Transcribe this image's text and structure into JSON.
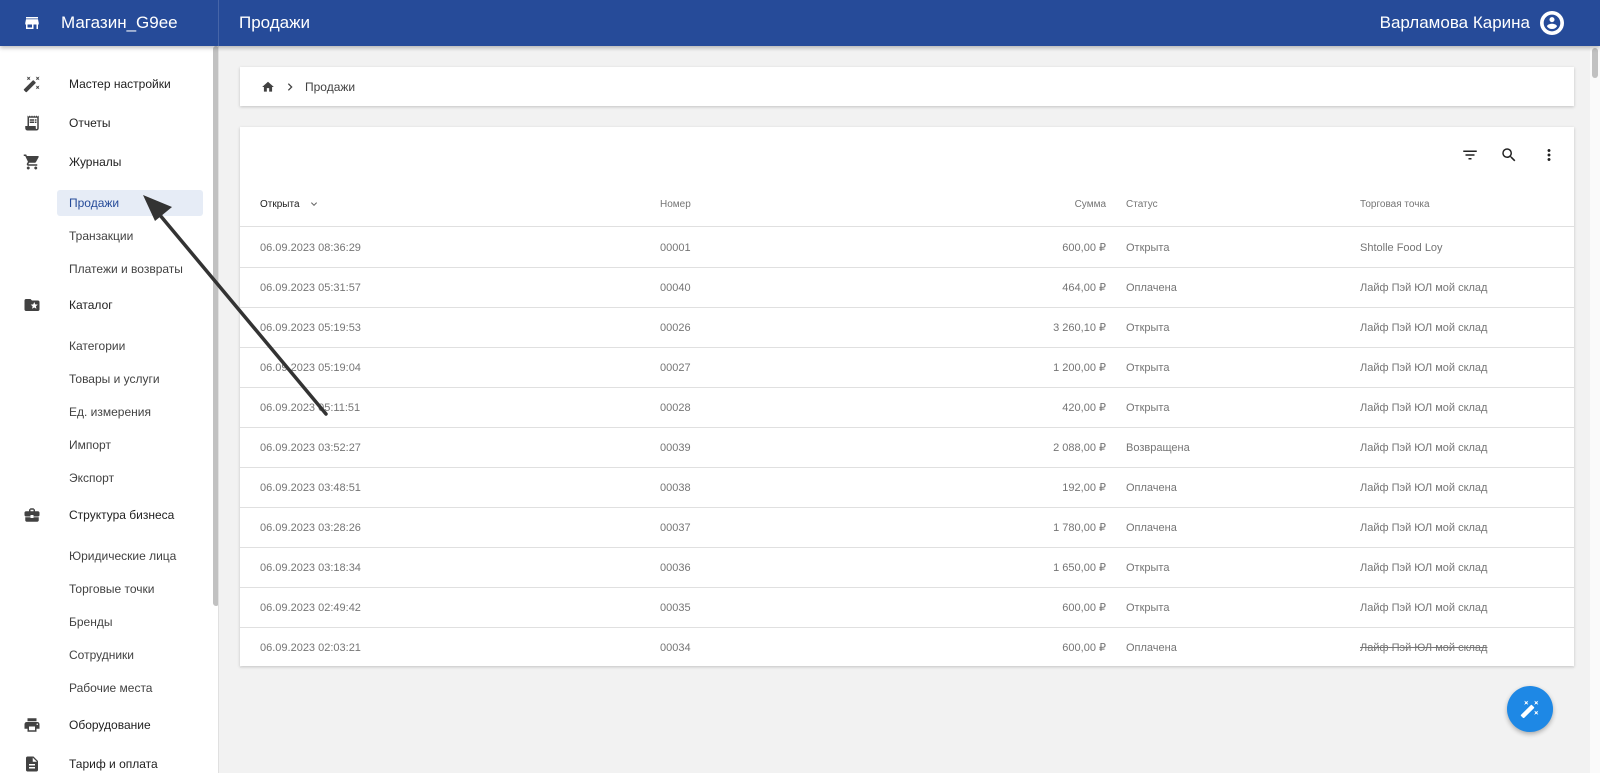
{
  "header": {
    "app_name": "Магазин_G9ee",
    "page_title": "Продажи",
    "user_name": "Варламова Карина"
  },
  "sidebar": {
    "sections": [
      {
        "label": "Мастер настройки",
        "icon": "magic-wand-icon"
      },
      {
        "label": "Отчеты",
        "icon": "receipt-icon"
      },
      {
        "label": "Журналы",
        "icon": "cart-icon",
        "children": [
          {
            "label": "Продажи",
            "active": true
          },
          {
            "label": "Транзакции"
          },
          {
            "label": "Платежи и возвраты"
          }
        ]
      },
      {
        "label": "Каталог",
        "icon": "folder-star-icon",
        "children": [
          {
            "label": "Категории"
          },
          {
            "label": "Товары и услуги"
          },
          {
            "label": "Ед. измерения"
          },
          {
            "label": "Импорт"
          },
          {
            "label": "Экспорт"
          }
        ]
      },
      {
        "label": "Структура бизнеса",
        "icon": "briefcase-icon",
        "children": [
          {
            "label": "Юридические лица"
          },
          {
            "label": "Торговые точки"
          },
          {
            "label": "Бренды"
          },
          {
            "label": "Сотрудники"
          },
          {
            "label": "Рабочие места"
          }
        ]
      },
      {
        "label": "Оборудование",
        "icon": "printer-icon"
      },
      {
        "label": "Тариф и оплата",
        "icon": "billing-icon"
      }
    ]
  },
  "breadcrumb": {
    "current": "Продажи"
  },
  "table": {
    "columns": {
      "opened": "Открыта",
      "number": "Номер",
      "sum": "Сумма",
      "status": "Статус",
      "outlet": "Торговая точка"
    },
    "rows": [
      {
        "opened": "06.09.2023 08:36:29",
        "number": "00001",
        "sum": "600,00 ₽",
        "status": "Открыта",
        "outlet": "Shtolle Food Loy"
      },
      {
        "opened": "06.09.2023 05:31:57",
        "number": "00040",
        "sum": "464,00 ₽",
        "status": "Оплачена",
        "outlet": "Лайф Пэй ЮЛ мой склад"
      },
      {
        "opened": "06.09.2023 05:19:53",
        "number": "00026",
        "sum": "3 260,10 ₽",
        "status": "Открыта",
        "outlet": "Лайф Пэй ЮЛ мой склад"
      },
      {
        "opened": "06.09.2023 05:19:04",
        "number": "00027",
        "sum": "1 200,00 ₽",
        "status": "Открыта",
        "outlet": "Лайф Пэй ЮЛ мой склад"
      },
      {
        "opened": "06.09.2023 05:11:51",
        "number": "00028",
        "sum": "420,00 ₽",
        "status": "Открыта",
        "outlet": "Лайф Пэй ЮЛ мой склад"
      },
      {
        "opened": "06.09.2023 03:52:27",
        "number": "00039",
        "sum": "2 088,00 ₽",
        "status": "Возвращена",
        "outlet": "Лайф Пэй ЮЛ мой склад"
      },
      {
        "opened": "06.09.2023 03:48:51",
        "number": "00038",
        "sum": "192,00 ₽",
        "status": "Оплачена",
        "outlet": "Лайф Пэй ЮЛ мой склад"
      },
      {
        "opened": "06.09.2023 03:28:26",
        "number": "00037",
        "sum": "1 780,00 ₽",
        "status": "Оплачена",
        "outlet": "Лайф Пэй ЮЛ мой склад"
      },
      {
        "opened": "06.09.2023 03:18:34",
        "number": "00036",
        "sum": "1 650,00 ₽",
        "status": "Открыта",
        "outlet": "Лайф Пэй ЮЛ мой склад"
      },
      {
        "opened": "06.09.2023 02:49:42",
        "number": "00035",
        "sum": "600,00 ₽",
        "status": "Открыта",
        "outlet": "Лайф Пэй ЮЛ мой склад"
      },
      {
        "opened": "06.09.2023 02:03:21",
        "number": "00034",
        "sum": "600,00 ₽",
        "status": "Оплачена",
        "outlet": "Лайф Пэй ЮЛ мой склад",
        "outlet_strikethrough": true
      }
    ]
  },
  "toolbar": {
    "icons": [
      "filter-icon",
      "search-icon",
      "more-vert-icon"
    ]
  },
  "fab": {
    "icon": "magic-wand-icon"
  },
  "colors": {
    "header_bg": "#264b99",
    "active_item_bg": "#e6ecf6",
    "fab_bg": "#1e88e5",
    "annotation_arrow": "#333333"
  }
}
